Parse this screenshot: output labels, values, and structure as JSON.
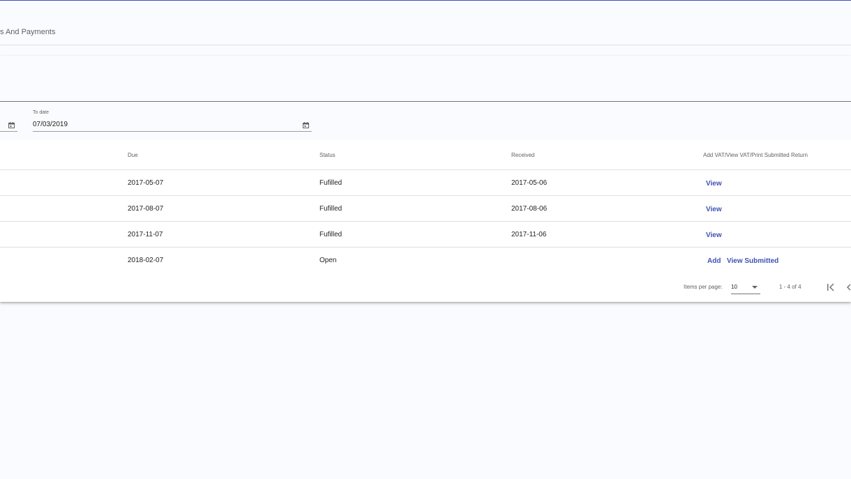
{
  "tab": {
    "label": "s And Payments"
  },
  "filters": {
    "to_label": "To date",
    "to_value": "07/03/2019"
  },
  "table": {
    "columns": [
      "Due",
      "Status",
      "Received",
      "Add VAT/View VAT/Print Submitted Return"
    ],
    "rows": [
      {
        "due": "2017-05-07",
        "status": "Fufilled",
        "received": "2017-05-06",
        "actions": [
          "View"
        ]
      },
      {
        "due": "2017-08-07",
        "status": "Fufilled",
        "received": "2017-08-06",
        "actions": [
          "View"
        ]
      },
      {
        "due": "2017-11-07",
        "status": "Fufilled",
        "received": "2017-11-06",
        "actions": [
          "View"
        ]
      },
      {
        "due": "2018-02-07",
        "status": "Open",
        "received": "",
        "actions": [
          "Add",
          "View Submitted"
        ]
      }
    ]
  },
  "paginator": {
    "items_per_page_label": "Items per page:",
    "items_per_page_value": "10",
    "range_label": "1 - 4 of 4"
  },
  "icons": {
    "calendar": "calendar-icon",
    "first_page": "first-page-icon",
    "previous_page": "previous-page-icon",
    "dropdown": "chevron-down-icon"
  },
  "colors": {
    "accent": "#3f51b5",
    "background": "#fafbfe"
  }
}
